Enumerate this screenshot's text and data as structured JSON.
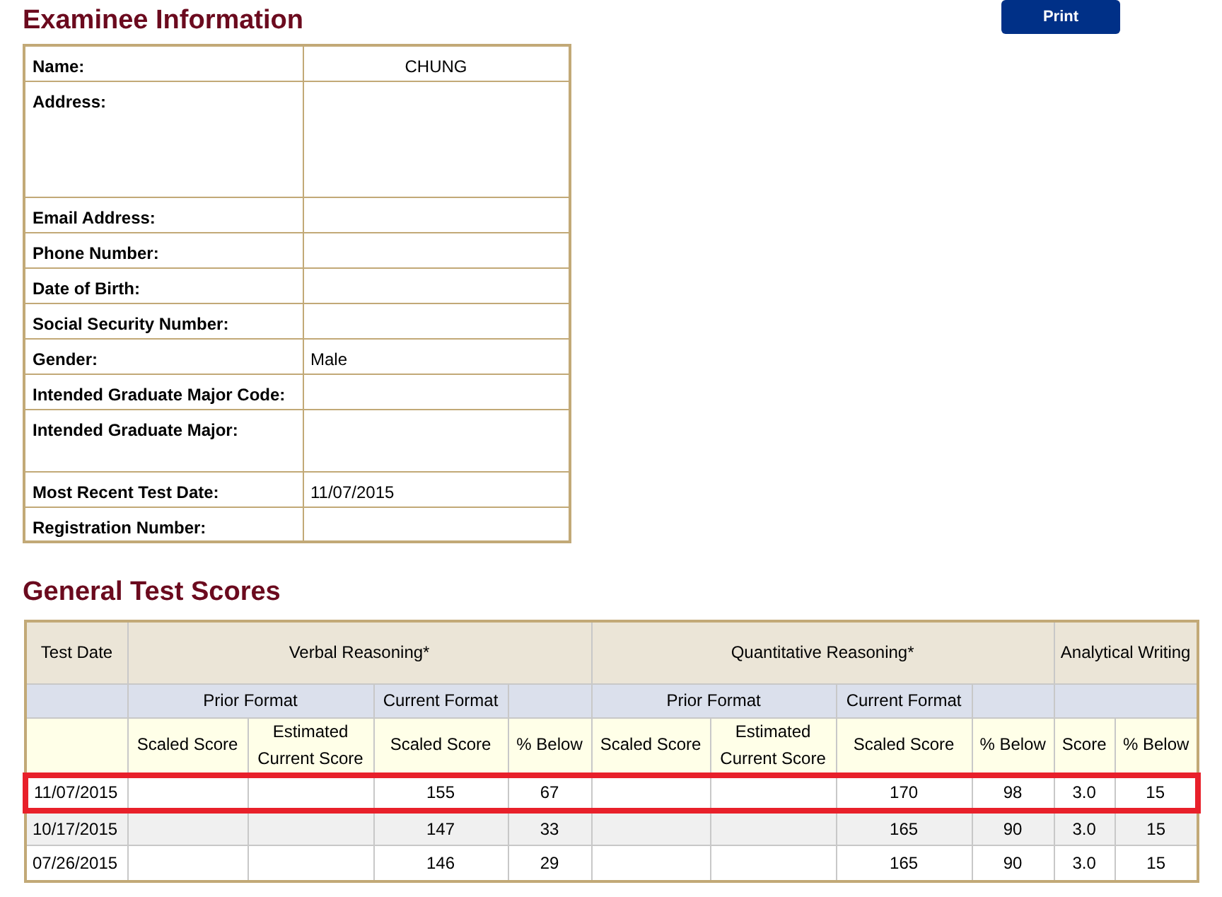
{
  "examinee": {
    "title": "Examinee Information",
    "fields": [
      {
        "label": "Name:",
        "value": "CHUNG"
      },
      {
        "label": "Address:"
      },
      {
        "label": "Email Address:"
      },
      {
        "label": "Phone Number:"
      },
      {
        "label": "Date of Birth:"
      },
      {
        "label": "Social Security Number:"
      },
      {
        "label": "Gender:",
        "value": "Male"
      },
      {
        "label": "Intended Graduate Major Code:"
      },
      {
        "label": "Intended Graduate Major:"
      },
      {
        "label": "Most Recent Test Date:",
        "value": "11/07/2015"
      },
      {
        "label": "Registration Number:"
      }
    ]
  },
  "print_button": "Print",
  "scores": {
    "title": "General Test Scores",
    "test_date_heading": "Test Date",
    "sections": [
      {
        "title": "Verbal Reasoning*",
        "subheads": [
          "Prior Format",
          "Current Format"
        ],
        "columns": [
          "Scaled Score",
          "Estimated Current Score",
          "Scaled Score",
          "% Below"
        ]
      },
      {
        "title": "Quantitative Reasoning*",
        "subheads": [
          "Prior Format",
          "Current Format"
        ],
        "columns": [
          "Scaled Score",
          "Estimated Current Score",
          "Scaled Score",
          "% Below"
        ]
      },
      {
        "title": "Analytical Writing",
        "columns": [
          "Score",
          "% Below"
        ]
      }
    ],
    "rows": [
      {
        "test_date": "11/07/2015",
        "highlighted": true,
        "cells": [
          null,
          null,
          "155",
          "67",
          null,
          null,
          "170",
          "98",
          "3.0",
          "15"
        ]
      },
      {
        "test_date": "10/17/2015",
        "highlighted": false,
        "cells": [
          null,
          null,
          "147",
          "33",
          null,
          null,
          "165",
          "90",
          "3.0",
          "15"
        ]
      },
      {
        "test_date": "07/26/2015",
        "highlighted": false,
        "cells": [
          null,
          null,
          "146",
          "29",
          null,
          null,
          "165",
          "90",
          "3.0",
          "15"
        ]
      }
    ]
  }
}
